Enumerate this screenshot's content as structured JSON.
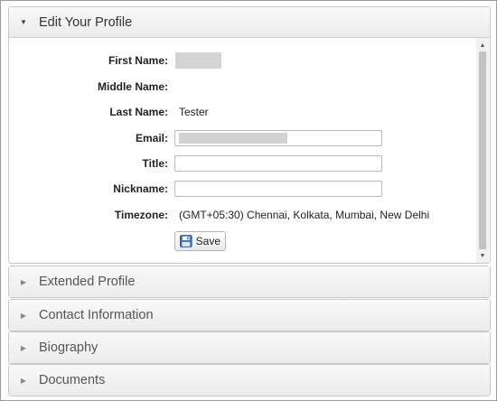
{
  "profile": {
    "title": "Edit Your Profile",
    "fields": {
      "first_name_label": "First Name:",
      "middle_name_label": "Middle Name:",
      "last_name_label": "Last Name:",
      "last_name_value": "Tester",
      "email_label": "Email:",
      "title_label": "Title:",
      "title_value": "",
      "nickname_label": "Nickname:",
      "nickname_value": "",
      "timezone_label": "Timezone:",
      "timezone_value": "(GMT+05:30) Chennai, Kolkata, Mumbai, New Delhi"
    },
    "save_label": "Save"
  },
  "sections": [
    {
      "title": "Extended Profile"
    },
    {
      "title": "Contact Information"
    },
    {
      "title": "Biography"
    },
    {
      "title": "Documents"
    }
  ],
  "colors": {
    "header_gradient_top": "#f9f9f9",
    "header_gradient_bottom": "#ececec",
    "border": "#c8c8c8",
    "save_icon": "#3b78c3"
  },
  "icons": {
    "expanded": "triangle-down-icon",
    "collapsed": "triangle-right-icon",
    "save": "floppy-disk-icon"
  }
}
